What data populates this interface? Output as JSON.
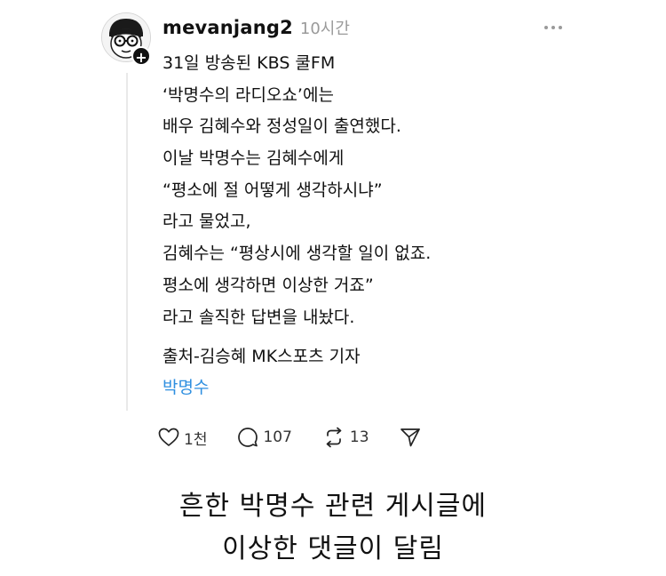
{
  "post": {
    "author": {
      "username": "mevanjang2",
      "timestamp": "10시간",
      "avatar_icon": "cartoon-face-with-glasses",
      "follow_icon": "plus-icon"
    },
    "body_lines": [
      "31일 방송된 KBS 쿨FM",
      "‘박명수의 라디오쇼’에는",
      "배우 김혜수와 정성일이 출연했다.",
      "이날 박명수는 김혜수에게",
      "“평소에 절 어떻게 생각하시냐”",
      "라고 물었고,",
      "김혜수는 “평상시에 생각할 일이 없죠.",
      "평소에 생각하면 이상한 거죠”",
      "라고 솔직한 답변을 내놨다."
    ],
    "source": "출처-김승혜 MK스포츠 기자",
    "hashtag": "박명수",
    "hashtag_color": "#2f8fe0",
    "actions": {
      "like": {
        "icon": "heart-icon",
        "count": "1천"
      },
      "reply": {
        "icon": "comment-icon",
        "count": "107"
      },
      "repost": {
        "icon": "repost-icon",
        "count": "13"
      },
      "share": {
        "icon": "send-icon"
      }
    }
  },
  "caption": {
    "line1": "흔한 박명수 관련 게시글에",
    "line2": "이상한 댓글이 달림"
  }
}
